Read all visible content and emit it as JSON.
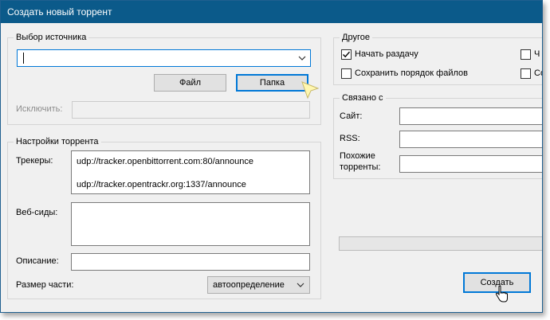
{
  "window": {
    "title": "Создать новый торрент"
  },
  "source": {
    "legend": "Выбор источника",
    "path_value": "",
    "file_button": "Файл",
    "folder_button": "Папка",
    "exclude_label": "Исключить:",
    "exclude_value": ""
  },
  "torrent_settings": {
    "legend": "Настройки торрента",
    "trackers_label": "Трекеры:",
    "trackers": [
      "udp://tracker.openbittorrent.com:80/announce",
      "udp://tracker.opentrackr.org:1337/announce"
    ],
    "webseeds_label": "Веб-сиды:",
    "webseeds_value": "",
    "description_label": "Описание:",
    "description_value": "",
    "piece_size_label": "Размер части:",
    "piece_size_value": "автоопределение"
  },
  "other": {
    "legend": "Другое",
    "start_seeding": {
      "label": "Начать раздачу",
      "checked": true
    },
    "preserve_order": {
      "label": "Сохранить порядок файлов",
      "checked": false
    },
    "cut_right_1": "Ч",
    "cut_right_2": "Со"
  },
  "related": {
    "legend": "Связано с",
    "site_label": "Сайт:",
    "rss_label": "RSS:",
    "similar_label_1": "Похожие",
    "similar_label_2": "торренты:"
  },
  "create_button": "Создать",
  "colors": {
    "titlebar": "#0b5a8a",
    "focus_blue": "#0078d7",
    "window_bg": "#f0f0f0"
  }
}
